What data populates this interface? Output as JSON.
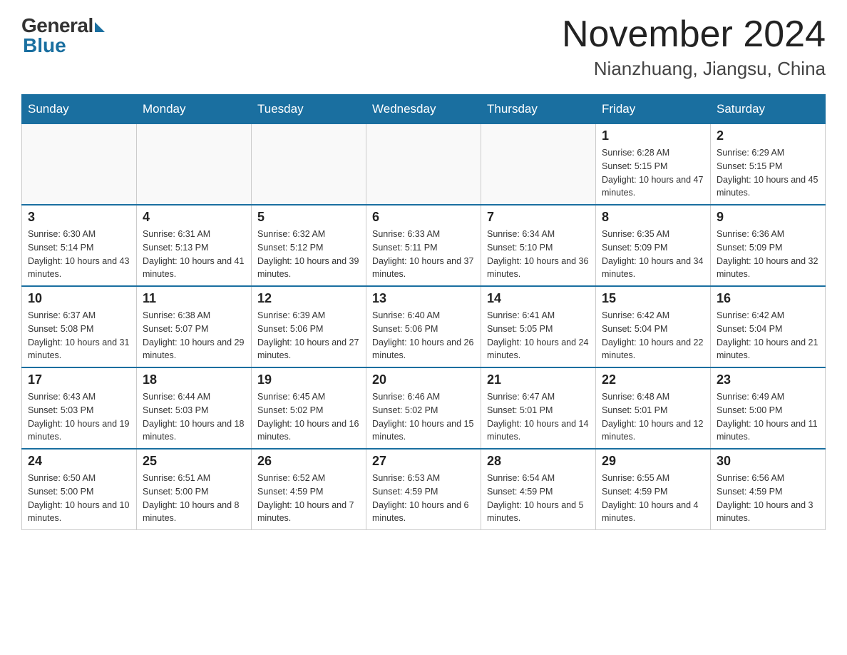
{
  "logo": {
    "general": "General",
    "blue": "Blue"
  },
  "title": "November 2024",
  "location": "Nianzhuang, Jiangsu, China",
  "weekdays": [
    "Sunday",
    "Monday",
    "Tuesday",
    "Wednesday",
    "Thursday",
    "Friday",
    "Saturday"
  ],
  "weeks": [
    [
      {
        "day": "",
        "info": ""
      },
      {
        "day": "",
        "info": ""
      },
      {
        "day": "",
        "info": ""
      },
      {
        "day": "",
        "info": ""
      },
      {
        "day": "",
        "info": ""
      },
      {
        "day": "1",
        "info": "Sunrise: 6:28 AM\nSunset: 5:15 PM\nDaylight: 10 hours and 47 minutes."
      },
      {
        "day": "2",
        "info": "Sunrise: 6:29 AM\nSunset: 5:15 PM\nDaylight: 10 hours and 45 minutes."
      }
    ],
    [
      {
        "day": "3",
        "info": "Sunrise: 6:30 AM\nSunset: 5:14 PM\nDaylight: 10 hours and 43 minutes."
      },
      {
        "day": "4",
        "info": "Sunrise: 6:31 AM\nSunset: 5:13 PM\nDaylight: 10 hours and 41 minutes."
      },
      {
        "day": "5",
        "info": "Sunrise: 6:32 AM\nSunset: 5:12 PM\nDaylight: 10 hours and 39 minutes."
      },
      {
        "day": "6",
        "info": "Sunrise: 6:33 AM\nSunset: 5:11 PM\nDaylight: 10 hours and 37 minutes."
      },
      {
        "day": "7",
        "info": "Sunrise: 6:34 AM\nSunset: 5:10 PM\nDaylight: 10 hours and 36 minutes."
      },
      {
        "day": "8",
        "info": "Sunrise: 6:35 AM\nSunset: 5:09 PM\nDaylight: 10 hours and 34 minutes."
      },
      {
        "day": "9",
        "info": "Sunrise: 6:36 AM\nSunset: 5:09 PM\nDaylight: 10 hours and 32 minutes."
      }
    ],
    [
      {
        "day": "10",
        "info": "Sunrise: 6:37 AM\nSunset: 5:08 PM\nDaylight: 10 hours and 31 minutes."
      },
      {
        "day": "11",
        "info": "Sunrise: 6:38 AM\nSunset: 5:07 PM\nDaylight: 10 hours and 29 minutes."
      },
      {
        "day": "12",
        "info": "Sunrise: 6:39 AM\nSunset: 5:06 PM\nDaylight: 10 hours and 27 minutes."
      },
      {
        "day": "13",
        "info": "Sunrise: 6:40 AM\nSunset: 5:06 PM\nDaylight: 10 hours and 26 minutes."
      },
      {
        "day": "14",
        "info": "Sunrise: 6:41 AM\nSunset: 5:05 PM\nDaylight: 10 hours and 24 minutes."
      },
      {
        "day": "15",
        "info": "Sunrise: 6:42 AM\nSunset: 5:04 PM\nDaylight: 10 hours and 22 minutes."
      },
      {
        "day": "16",
        "info": "Sunrise: 6:42 AM\nSunset: 5:04 PM\nDaylight: 10 hours and 21 minutes."
      }
    ],
    [
      {
        "day": "17",
        "info": "Sunrise: 6:43 AM\nSunset: 5:03 PM\nDaylight: 10 hours and 19 minutes."
      },
      {
        "day": "18",
        "info": "Sunrise: 6:44 AM\nSunset: 5:03 PM\nDaylight: 10 hours and 18 minutes."
      },
      {
        "day": "19",
        "info": "Sunrise: 6:45 AM\nSunset: 5:02 PM\nDaylight: 10 hours and 16 minutes."
      },
      {
        "day": "20",
        "info": "Sunrise: 6:46 AM\nSunset: 5:02 PM\nDaylight: 10 hours and 15 minutes."
      },
      {
        "day": "21",
        "info": "Sunrise: 6:47 AM\nSunset: 5:01 PM\nDaylight: 10 hours and 14 minutes."
      },
      {
        "day": "22",
        "info": "Sunrise: 6:48 AM\nSunset: 5:01 PM\nDaylight: 10 hours and 12 minutes."
      },
      {
        "day": "23",
        "info": "Sunrise: 6:49 AM\nSunset: 5:00 PM\nDaylight: 10 hours and 11 minutes."
      }
    ],
    [
      {
        "day": "24",
        "info": "Sunrise: 6:50 AM\nSunset: 5:00 PM\nDaylight: 10 hours and 10 minutes."
      },
      {
        "day": "25",
        "info": "Sunrise: 6:51 AM\nSunset: 5:00 PM\nDaylight: 10 hours and 8 minutes."
      },
      {
        "day": "26",
        "info": "Sunrise: 6:52 AM\nSunset: 4:59 PM\nDaylight: 10 hours and 7 minutes."
      },
      {
        "day": "27",
        "info": "Sunrise: 6:53 AM\nSunset: 4:59 PM\nDaylight: 10 hours and 6 minutes."
      },
      {
        "day": "28",
        "info": "Sunrise: 6:54 AM\nSunset: 4:59 PM\nDaylight: 10 hours and 5 minutes."
      },
      {
        "day": "29",
        "info": "Sunrise: 6:55 AM\nSunset: 4:59 PM\nDaylight: 10 hours and 4 minutes."
      },
      {
        "day": "30",
        "info": "Sunrise: 6:56 AM\nSunset: 4:59 PM\nDaylight: 10 hours and 3 minutes."
      }
    ]
  ]
}
